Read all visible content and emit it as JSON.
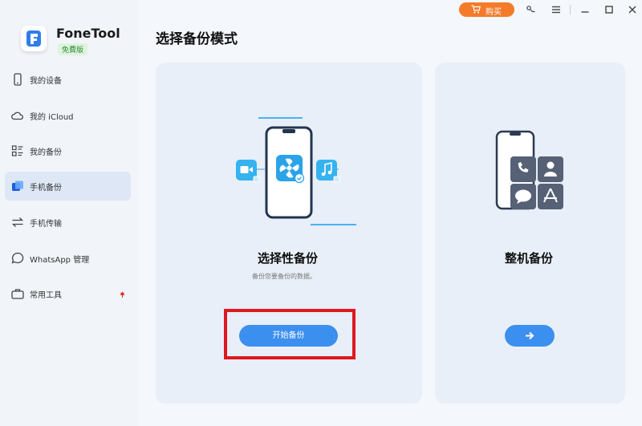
{
  "app": {
    "name": "FoneTool",
    "edition": "免費版"
  },
  "topbar": {
    "buy_label": "购买"
  },
  "sidebar": {
    "items": [
      {
        "label": "我的设备",
        "icon": "phone-icon"
      },
      {
        "label": "我的 iCloud",
        "icon": "cloud-icon"
      },
      {
        "label": "我的备份",
        "icon": "grid-list-icon"
      },
      {
        "label": "手机备份",
        "icon": "backup-layers-icon",
        "active": true
      },
      {
        "label": "手机传输",
        "icon": "transfer-arrows-icon"
      },
      {
        "label": "WhatsApp 管理",
        "icon": "chat-bubble-icon"
      },
      {
        "label": "常用工具",
        "icon": "toolbox-icon",
        "badge": "red-maple-icon"
      }
    ]
  },
  "main": {
    "title": "选择备份模式",
    "selective": {
      "title": "选择性备份",
      "description": "备份您要备份的数据。",
      "button": "开始备份"
    },
    "full": {
      "title": "整机备份"
    }
  },
  "colors": {
    "accent": "#3b8fef",
    "buy": "#f47b2a",
    "highlight": "#e0181f",
    "card": "#e8eff8"
  }
}
